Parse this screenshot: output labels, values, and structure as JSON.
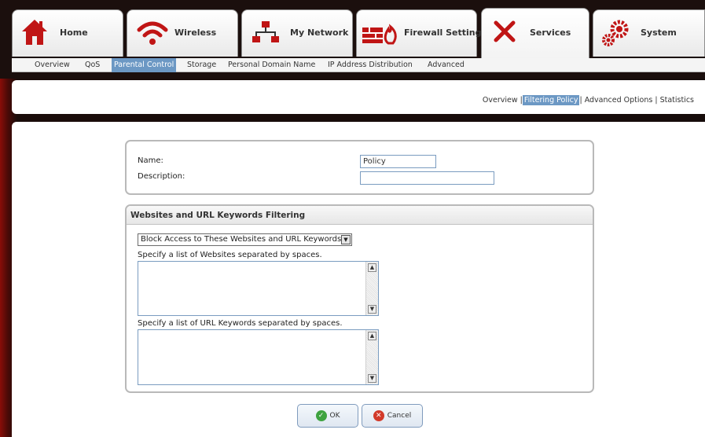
{
  "tabs": [
    {
      "label": "Home",
      "icon": "house-icon"
    },
    {
      "label": "Wireless",
      "icon": "wifi-icon"
    },
    {
      "label": "My Network",
      "icon": "network-icon"
    },
    {
      "label": "Firewall Settings",
      "icon": "firewall-icon"
    },
    {
      "label": "Services",
      "icon": "tools-icon",
      "active": true
    },
    {
      "label": "System",
      "icon": "gears-icon"
    }
  ],
  "subnav": [
    {
      "label": "Overview"
    },
    {
      "label": "QoS"
    },
    {
      "label": "Parental Control",
      "active": true
    },
    {
      "label": "Storage"
    },
    {
      "label": "Personal Domain Name"
    },
    {
      "label": "IP Address Distribution"
    },
    {
      "label": "Advanced"
    }
  ],
  "pagelinks": {
    "overview": "Overview",
    "sep1": "|",
    "filtering": "Filtering Policy",
    "sep2": "|",
    "advanced": "Advanced Options",
    "sep3": "|",
    "statistics": "Statistics"
  },
  "policy": {
    "name_label": "Name:",
    "name_value": "Policy",
    "description_label": "Description:",
    "description_value": ""
  },
  "filtering": {
    "header": "Websites and URL Keywords Filtering",
    "mode_selected": "Block Access to These Websites and URL Keywords",
    "websites_label": "Specify a list of Websites separated by spaces.",
    "keywords_label": "Specify a list of URL Keywords separated by spaces."
  },
  "buttons": {
    "ok": "OK",
    "cancel": "Cancel"
  },
  "colors": {
    "accent": "#6c98c4",
    "frame": "#1b0f0d",
    "brand_red": "#c01515"
  }
}
